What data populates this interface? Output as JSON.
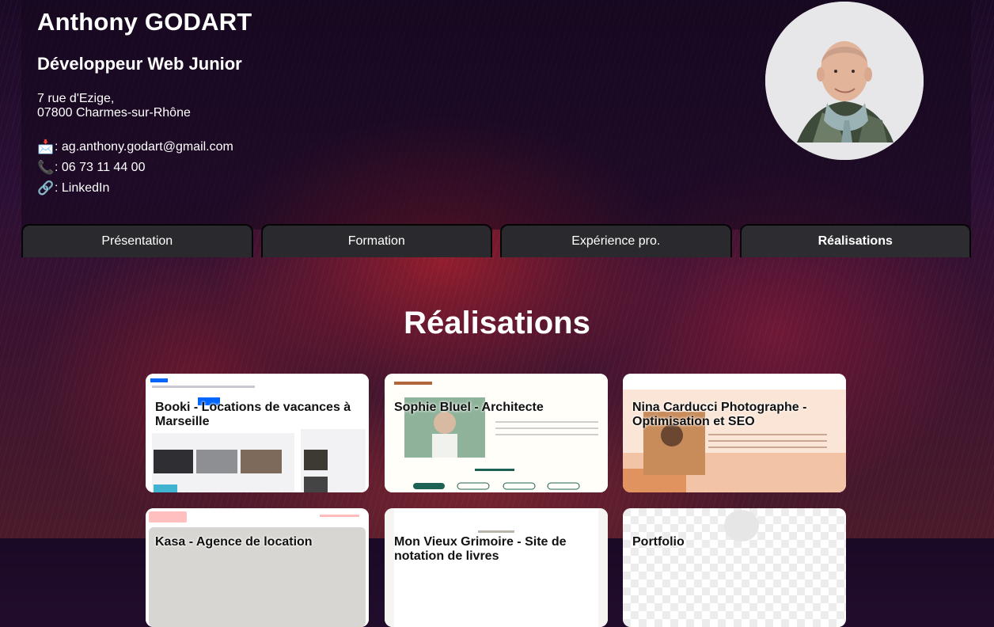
{
  "profile": {
    "name": "Anthony GODART",
    "title": "Développeur Web Junior",
    "address_line1": "7 rue d'Ezige,",
    "address_line2": "07800 Charmes-sur-Rhône",
    "email_icon": "📩",
    "email_text": ": ag.anthony.godart@gmail.com",
    "phone_icon": "📞",
    "phone_text": ": 06 73 11 44 00",
    "linkedin_icon": "🔗",
    "linkedin_prefix": ": ",
    "linkedin_label": "LinkedIn"
  },
  "tabs": [
    {
      "label": "Présentation",
      "active": false
    },
    {
      "label": "Formation",
      "active": false
    },
    {
      "label": "Expérience pro.",
      "active": false
    },
    {
      "label": "Réalisations",
      "active": true
    }
  ],
  "realisations": {
    "heading": "Réalisations",
    "projects": [
      {
        "title": "Booki - Locations de vacances à Marseille"
      },
      {
        "title": "Sophie Bluel - Architecte"
      },
      {
        "title": "Nina Carducci Photographe - Optimisation et SEO"
      },
      {
        "title": "Kasa - Agence de location"
      },
      {
        "title": "Mon Vieux Grimoire - Site de notation de livres"
      },
      {
        "title": "Portfolio"
      }
    ]
  },
  "colors": {
    "tab_bg": "#2a2a2e",
    "accent_booki": "#0065fc",
    "accent_sophie": "#1d6154",
    "accent_nina": "#f3c3a5",
    "accent_kasa": "#ff6060"
  }
}
